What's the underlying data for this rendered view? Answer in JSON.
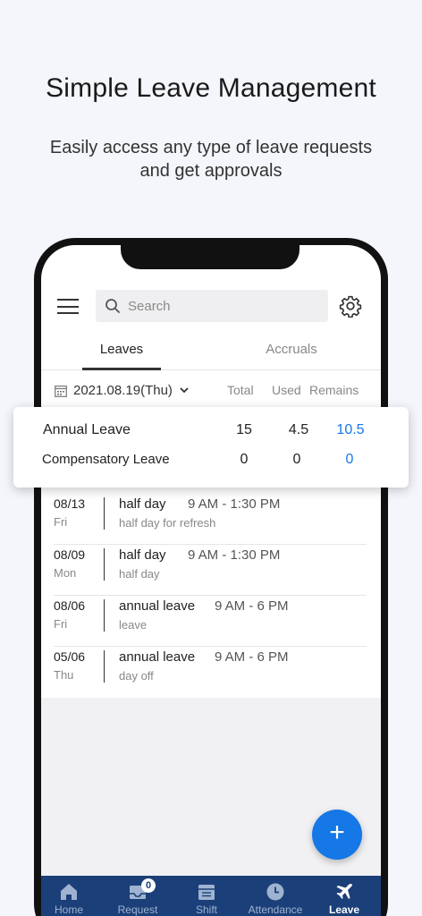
{
  "hero": {
    "title": "Simple Leave Management",
    "subtitle_line1": "Easily access any type of leave requests",
    "subtitle_line2": "and get approvals"
  },
  "topbar": {
    "search_placeholder": "Search",
    "menu_icon": "hamburger-menu-icon",
    "settings_icon": "gear-icon"
  },
  "tabs": [
    {
      "label": "Leaves",
      "active": true
    },
    {
      "label": "Accruals",
      "active": false
    }
  ],
  "date_filter": {
    "value": "2021.08.19(Thu)",
    "columns": [
      "Total",
      "Used",
      "Remains"
    ]
  },
  "summary": [
    {
      "name": "Annual Leave",
      "total": "15",
      "used": "4.5",
      "remains": "10.5"
    },
    {
      "name": "Compensatory Leave",
      "total": "0",
      "used": "0",
      "remains": "0"
    }
  ],
  "leaves": [
    {
      "date": "08/13",
      "day": "Fri",
      "type": "half day",
      "time": "9 AM - 1:30 PM",
      "note": "half day for refresh"
    },
    {
      "date": "08/09",
      "day": "Mon",
      "type": "half day",
      "time": "9 AM - 1:30 PM",
      "note": "half day"
    },
    {
      "date": "08/06",
      "day": "Fri",
      "type": "annual leave",
      "time": "9 AM - 6 PM",
      "note": "leave"
    },
    {
      "date": "05/06",
      "day": "Thu",
      "type": "annual leave",
      "time": "9 AM - 6 PM",
      "note": "day off"
    }
  ],
  "fab": {
    "label": "+"
  },
  "nav": [
    {
      "label": "Home",
      "icon": "home-icon",
      "active": false
    },
    {
      "label": "Request",
      "icon": "inbox-icon",
      "active": false,
      "badge": "0"
    },
    {
      "label": "Shift",
      "icon": "calendar-icon",
      "active": false
    },
    {
      "label": "Attendance",
      "icon": "clock-icon",
      "active": false
    },
    {
      "label": "Leave",
      "icon": "airplane-icon",
      "active": true
    }
  ],
  "colors": {
    "accent": "#1677e6",
    "nav_bg": "#1b3f78",
    "remains_blue": "#1877e8",
    "page_bg": "#f4f6fb"
  }
}
